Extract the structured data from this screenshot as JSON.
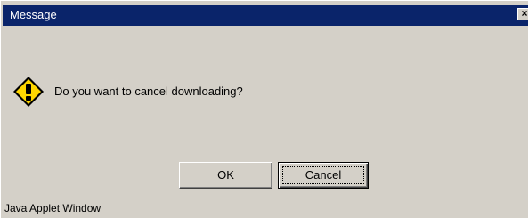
{
  "window": {
    "title": "Message",
    "close_glyph": "✕"
  },
  "dialog": {
    "icon": "warning-exclamation-icon",
    "message": "Do you want to cancel downloading?"
  },
  "buttons": {
    "ok_label": "OK",
    "cancel_label": "Cancel"
  },
  "status": {
    "text": "Java Applet Window"
  },
  "colors": {
    "titlebar": "#0a246a",
    "window_bg": "#d4d0c8",
    "icon_fill": "#ffd700"
  }
}
